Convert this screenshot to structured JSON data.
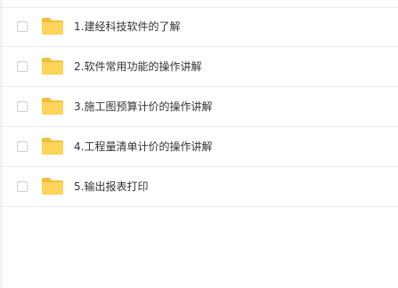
{
  "colors": {
    "folder_body": "#FDD45A",
    "folder_tab": "#F5BE3A",
    "text": "#333333",
    "divider": "#ECECEC"
  },
  "file_list": {
    "rows": [
      {
        "name": "1.建经科技软件的了解",
        "icon": "folder-icon"
      },
      {
        "name": "2.软件常用功能的操作讲解",
        "icon": "folder-icon"
      },
      {
        "name": "3.施工图预算计价的操作讲解",
        "icon": "folder-icon"
      },
      {
        "name": "4.工程量清单计价的操作讲解",
        "icon": "folder-icon"
      },
      {
        "name": "5.输出报表打印",
        "icon": "folder-icon"
      }
    ]
  }
}
